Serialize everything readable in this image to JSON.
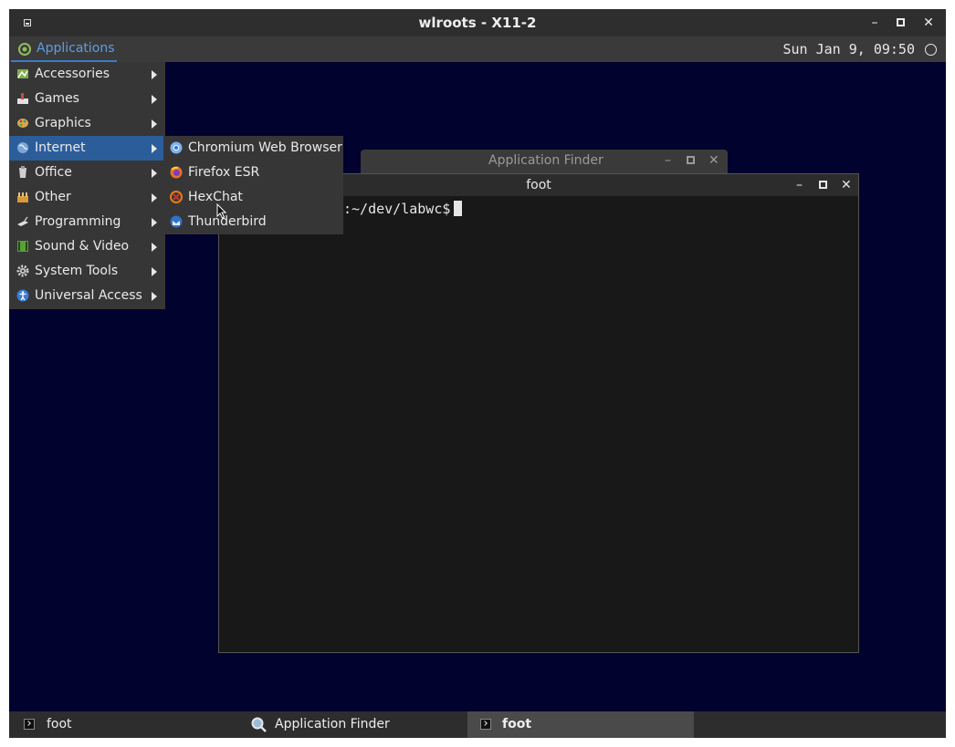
{
  "window": {
    "title": "wlroots - X11-2"
  },
  "panel": {
    "applications_label": "Applications",
    "clock": "Sun Jan  9, 09:50"
  },
  "main_menu": {
    "items": [
      {
        "label": "Accessories",
        "icon": "accessories-icon"
      },
      {
        "label": "Games",
        "icon": "games-icon"
      },
      {
        "label": "Graphics",
        "icon": "graphics-icon"
      },
      {
        "label": "Internet",
        "icon": "internet-icon",
        "active": true
      },
      {
        "label": "Office",
        "icon": "office-icon"
      },
      {
        "label": "Other",
        "icon": "other-icon"
      },
      {
        "label": "Programming",
        "icon": "programming-icon"
      },
      {
        "label": "Sound & Video",
        "icon": "sound-video-icon"
      },
      {
        "label": "System Tools",
        "icon": "system-tools-icon"
      },
      {
        "label": "Universal Access",
        "icon": "universal-access-icon"
      }
    ]
  },
  "sub_menu": {
    "items": [
      {
        "label": "Chromium Web Browser",
        "icon": "chromium-icon"
      },
      {
        "label": "Firefox ESR",
        "icon": "firefox-icon"
      },
      {
        "label": "HexChat",
        "icon": "hexchat-icon"
      },
      {
        "label": "Thunderbird",
        "icon": "thunderbird-icon"
      }
    ]
  },
  "app_finder": {
    "title": "Application Finder"
  },
  "terminal": {
    "title": "foot",
    "prompt": ":~/dev/labwc$"
  },
  "taskbar": {
    "tasks": [
      {
        "label": "foot"
      },
      {
        "label": "Application Finder"
      },
      {
        "label": "foot",
        "active": true
      }
    ]
  },
  "colors": {
    "desktop": "#02022e",
    "accent": "#2c5d9b",
    "menu_bg": "#363636"
  }
}
